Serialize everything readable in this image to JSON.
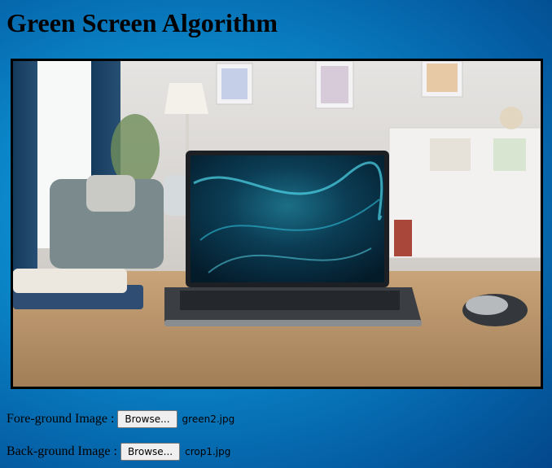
{
  "page": {
    "title": "Green Screen Algorithm"
  },
  "preview": {
    "alt": "composite image: laptop on wooden desk in living room"
  },
  "foreground": {
    "label": "Fore-ground Image :",
    "button_label": "Browse...",
    "file_name": "green2.jpg"
  },
  "background": {
    "label": "Back-ground Image :",
    "button_label": "Browse...",
    "file_name": "crop1.jpg"
  }
}
